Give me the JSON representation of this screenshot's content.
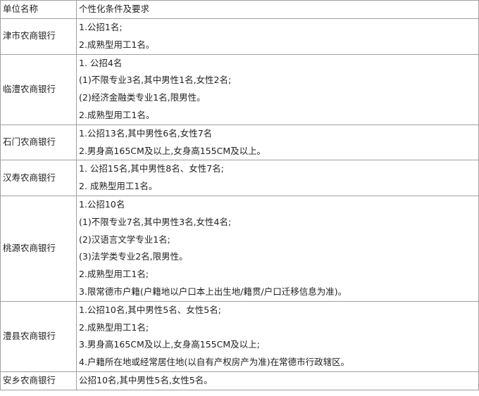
{
  "header": {
    "col_unit": "单位名称",
    "col_requirements": "个性化条件及要求"
  },
  "rows": [
    {
      "unit": "津市农商银行",
      "lines": [
        "1.公招1名;",
        "2.成熟型用工1名。"
      ]
    },
    {
      "unit": "临澧农商银行",
      "lines": [
        "1. 公招4名",
        "(1)不限专业3名,其中男性1名,女性2名;",
        "(2)经济金融类专业1名,限男性。",
        "2.成熟型用工1名。"
      ]
    },
    {
      "unit": "石门农商银行",
      "lines": [
        "1.公招13名,其中男性6名,女性7名",
        "2.男身高165CM及以上,女身高155CM及以上。"
      ]
    },
    {
      "unit": "汉寿农商银行",
      "lines": [
        "1. 公招15名,其中男性8名、女性7名;",
        "2. 成熟型用工1名。"
      ]
    },
    {
      "unit": "桃源农商银行",
      "lines": [
        "1.公招10名",
        "(1)不限专业7名,其中男性3名,女性4名;",
        "(2)汉语言文学专业1名;",
        "(3)法学类专业2名,限男性。",
        "2.成熟型用工1名;",
        "3.限常德市户籍(户籍地以户口本上出生地/籍贯/户口迁移信息为准)。"
      ]
    },
    {
      "unit": "澧县农商银行",
      "lines": [
        "1.公招10名,其中男性5名、女性5名;",
        "2.成熟型用工1名;",
        "3.男身高165CM及以上,女身高155CM及以上;",
        "4.户籍所在地或经常居住地(以自有产权房产为准)在常德市行政辖区。"
      ]
    },
    {
      "unit": "安乡农商银行",
      "lines": [
        "公招10名,其中男性5名,女性5名。"
      ]
    }
  ]
}
